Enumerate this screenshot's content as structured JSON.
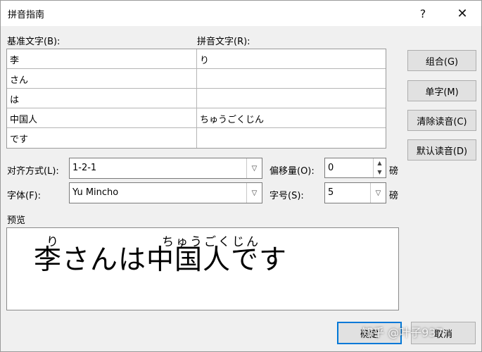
{
  "window": {
    "title": "拼音指南",
    "help_label": "?",
    "close_label": "✕"
  },
  "labels": {
    "base_text": "基准文字(B):",
    "ruby_text": "拼音文字(R):",
    "alignment": "对齐方式(L):",
    "offset": "偏移量(O):",
    "offset_unit": "磅",
    "font": "字体(F):",
    "size": "字号(S):",
    "size_unit": "磅",
    "preview": "预览"
  },
  "rows": [
    {
      "base": "李",
      "ruby": "り"
    },
    {
      "base": "さん",
      "ruby": ""
    },
    {
      "base": "は",
      "ruby": ""
    },
    {
      "base": "中国人",
      "ruby": "ちゅうごくじん"
    },
    {
      "base": "です",
      "ruby": ""
    }
  ],
  "buttons": {
    "group": "组合(G)",
    "mono": "单字(M)",
    "clear": "清除读音(C)",
    "default_reading": "默认读音(D)",
    "ok": "确定",
    "cancel": "取消"
  },
  "fields": {
    "alignment_value": "1-2-1",
    "offset_value": "0",
    "font_value": "Yu Mincho",
    "size_value": "5"
  },
  "preview": {
    "text": "李さんは中国人です",
    "ruby_ri": "り",
    "ruby_chinese": "ちゅうごくじん"
  },
  "watermark": "知乎 @叶子937",
  "colors": {
    "accent": "#0078d7",
    "dialog_bg": "#f0f0f0"
  }
}
